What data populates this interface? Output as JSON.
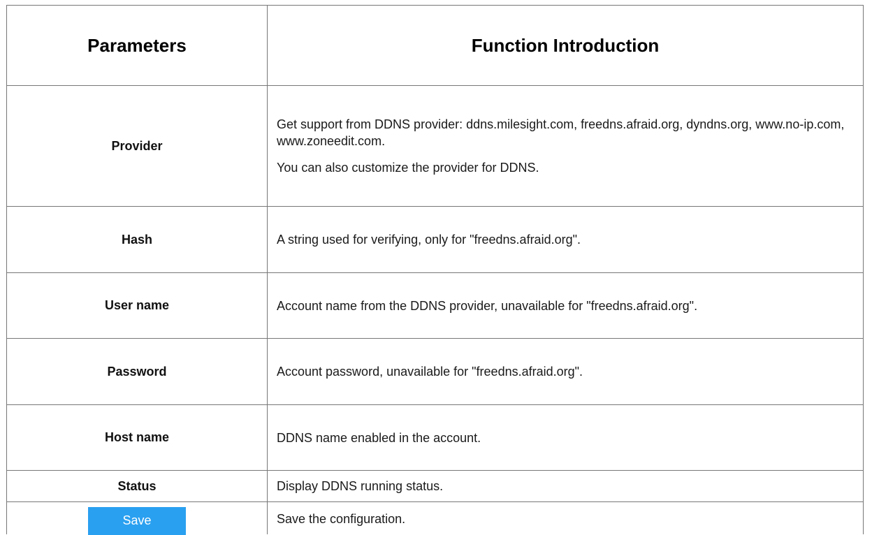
{
  "table": {
    "header": {
      "parameters": "Parameters",
      "function": "Function Introduction"
    },
    "rows": [
      {
        "param": "Provider",
        "desc_lines": [
          "Get support from DDNS provider: ddns.milesight.com, freedns.afraid.org, dyndns.org, www.no-ip.com, www.zoneedit.com.",
          "You can also customize the provider for DDNS."
        ]
      },
      {
        "param": "Hash",
        "desc_lines": [
          "A string used for verifying, only for \"freedns.afraid.org\"."
        ]
      },
      {
        "param": "User name",
        "desc_lines": [
          "Account name from the DDNS provider, unavailable for \"freedns.afraid.org\"."
        ]
      },
      {
        "param": "Password",
        "desc_lines": [
          "Account password, unavailable for \"freedns.afraid.org\"."
        ]
      },
      {
        "param": "Host name",
        "desc_lines": [
          "DDNS name enabled in the account."
        ]
      },
      {
        "param": "Status",
        "desc_lines": [
          "Display DDNS running status."
        ]
      },
      {
        "param_button": "Save",
        "desc_lines": [
          "Save the configuration."
        ]
      }
    ]
  },
  "colors": {
    "border": "#777777",
    "save_button_bg": "#2aa0f0",
    "save_button_text": "#ffffff"
  }
}
